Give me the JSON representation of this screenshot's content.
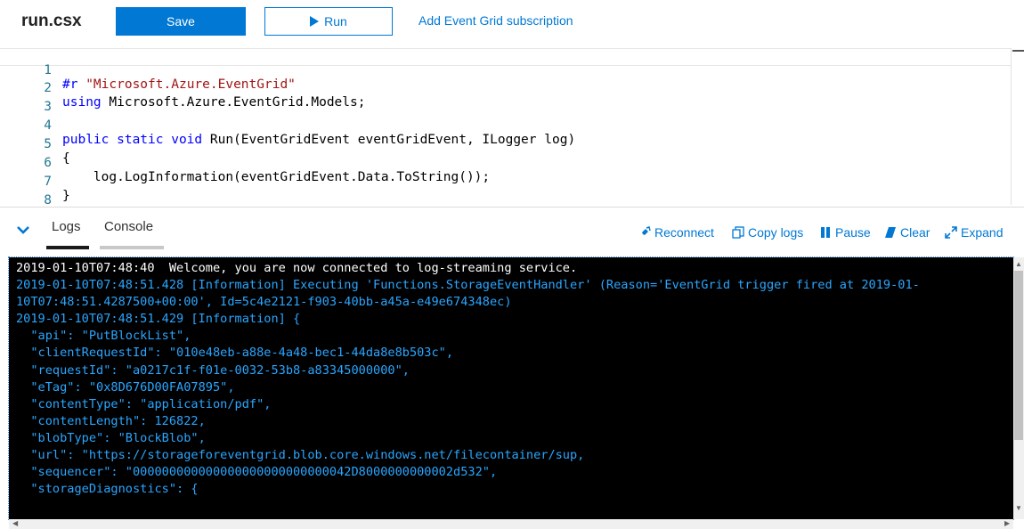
{
  "toolbar": {
    "file_name": "run.csx",
    "save_label": "Save",
    "run_label": "Run",
    "add_subscription_label": "Add Event Grid subscription"
  },
  "editor": {
    "lines": [
      {
        "num": "1",
        "text": "#r \"Microsoft.Azure.EventGrid\""
      },
      {
        "num": "2",
        "text": "using Microsoft.Azure.EventGrid.Models;"
      },
      {
        "num": "3",
        "text": ""
      },
      {
        "num": "4",
        "text": "public static void Run(EventGridEvent eventGridEvent, ILogger log)"
      },
      {
        "num": "5",
        "text": "{"
      },
      {
        "num": "6",
        "text": "    log.LogInformation(eventGridEvent.Data.ToString());"
      },
      {
        "num": "7",
        "text": "}"
      },
      {
        "num": "8",
        "text": ""
      }
    ]
  },
  "logs_panel": {
    "tabs": [
      {
        "label": "Logs",
        "active": true
      },
      {
        "label": "Console",
        "active": false
      }
    ],
    "actions": [
      {
        "label": "Reconnect",
        "icon": "reconnect-icon"
      },
      {
        "label": "Copy logs",
        "icon": "copy-icon"
      },
      {
        "label": "Pause",
        "icon": "pause-icon"
      },
      {
        "label": "Clear",
        "icon": "eraser-icon"
      },
      {
        "label": "Expand",
        "icon": "expand-icon"
      }
    ]
  },
  "console": {
    "lines": [
      {
        "text": "2019-01-10T07:48:40  Welcome, you are now connected to log-streaming service.",
        "color": "#ffffff"
      },
      {
        "text": "2019-01-10T07:48:51.428 [Information] Executing 'Functions.StorageEventHandler' (Reason='EventGrid trigger fired at 2019-01-",
        "color": "#2aa6ff"
      },
      {
        "text": "10T07:48:51.4287500+00:00', Id=5c4e2121-f903-40bb-a45a-e49e674348ec)",
        "color": "#2aa6ff"
      },
      {
        "text": "2019-01-10T07:48:51.429 [Information] {",
        "color": "#2aa6ff"
      },
      {
        "text": "  \"api\": \"PutBlockList\",",
        "color": "#2aa6ff"
      },
      {
        "text": "  \"clientRequestId\": \"010e48eb-a88e-4a48-bec1-44da8e8b503c\",",
        "color": "#2aa6ff"
      },
      {
        "text": "  \"requestId\": \"a0217c1f-f01e-0032-53b8-a83345000000\",",
        "color": "#2aa6ff"
      },
      {
        "text": "  \"eTag\": \"0x8D676D00FA07895\",",
        "color": "#2aa6ff"
      },
      {
        "text": "  \"contentType\": \"application/pdf\",",
        "color": "#2aa6ff"
      },
      {
        "text": "  \"contentLength\": 126822,",
        "color": "#2aa6ff"
      },
      {
        "text": "  \"blobType\": \"BlockBlob\",",
        "color": "#2aa6ff"
      },
      {
        "text": "  \"url\": \"https://storageforeventgrid.blob.core.windows.net/filecontainer/sup,",
        "color": "#2aa6ff"
      },
      {
        "text": "  \"sequencer\": \"000000000000000000000000000042D8000000000002d532\",",
        "color": "#2aa6ff"
      },
      {
        "text": "  \"storageDiagnostics\": {",
        "color": "#2aa6ff"
      }
    ]
  },
  "colors": {
    "accent": "#0078d4",
    "console_bg": "#000000",
    "log_info": "#2aa6ff"
  }
}
